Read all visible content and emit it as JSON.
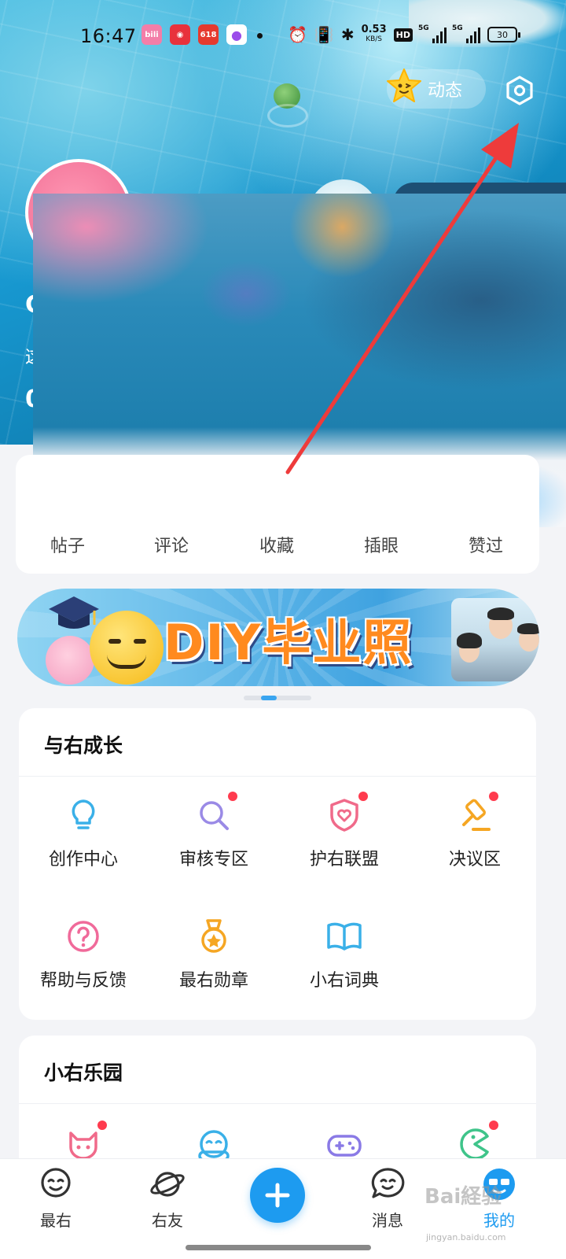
{
  "status_bar": {
    "time": "16:47",
    "apps": [
      {
        "icon": "bilibili-icon",
        "text": "bili",
        "color": "#f37ea8"
      },
      {
        "icon": "netease-music-icon",
        "text": "◉",
        "color": "#e8323c"
      },
      {
        "icon": "pinduoduo-618-icon",
        "text": "618",
        "color": "#e63a2e"
      },
      {
        "icon": "purple-app-icon",
        "text": "●",
        "color": "#9b4dea"
      }
    ],
    "net_speed_value": "0.53",
    "net_speed_unit": "KB/S",
    "hd_label": "HD",
    "signal_1_label": "5G",
    "signal_2_label": "5G",
    "battery": "30"
  },
  "header": {
    "dongtai_label": "动态",
    "profile_fragments": [
      "C",
      "这",
      "0"
    ]
  },
  "stats": {
    "items": [
      "帖子",
      "评论",
      "收藏",
      "插眼",
      "赞过"
    ]
  },
  "banner": {
    "title": "DIY毕业照"
  },
  "growth": {
    "title": "与右成长",
    "items": [
      {
        "label": "创作中心",
        "icon": "lightbulb-icon",
        "color": "#3ab0e8",
        "dot": false
      },
      {
        "label": "审核专区",
        "icon": "magnifier-icon",
        "color": "#9a8ae6",
        "dot": true
      },
      {
        "label": "护右联盟",
        "icon": "shield-heart-icon",
        "color": "#f06a8a",
        "dot": true
      },
      {
        "label": "决议区",
        "icon": "gavel-icon",
        "color": "#f5a623",
        "dot": true
      },
      {
        "label": "帮助与反馈",
        "icon": "help-circle-icon",
        "color": "#f06a9a",
        "dot": false
      },
      {
        "label": "最右勋章",
        "icon": "medal-icon",
        "color": "#f5a623",
        "dot": false
      },
      {
        "label": "小右词典",
        "icon": "book-icon",
        "color": "#3ab0e8",
        "dot": false
      }
    ]
  },
  "park": {
    "title": "小右乐园",
    "items": [
      {
        "icon": "devil-cat-icon",
        "color": "#f06a8a",
        "dot": true
      },
      {
        "icon": "headphone-face-icon",
        "color": "#3ab0e8",
        "dot": false
      },
      {
        "icon": "gamepad-icon",
        "color": "#8a7ae6",
        "dot": false
      },
      {
        "icon": "pacman-icon",
        "color": "#3fc48a",
        "dot": true
      }
    ]
  },
  "bottom_nav": {
    "items": [
      {
        "label": "最右",
        "icon": "smile-face-icon"
      },
      {
        "label": "右友",
        "icon": "planet-icon"
      },
      {
        "label": "消息",
        "icon": "chat-face-icon"
      },
      {
        "label": "我的",
        "icon": "profile-face-icon"
      }
    ]
  },
  "watermark": {
    "main": "Bai経验",
    "sub": "jingyan.baidu.com"
  }
}
